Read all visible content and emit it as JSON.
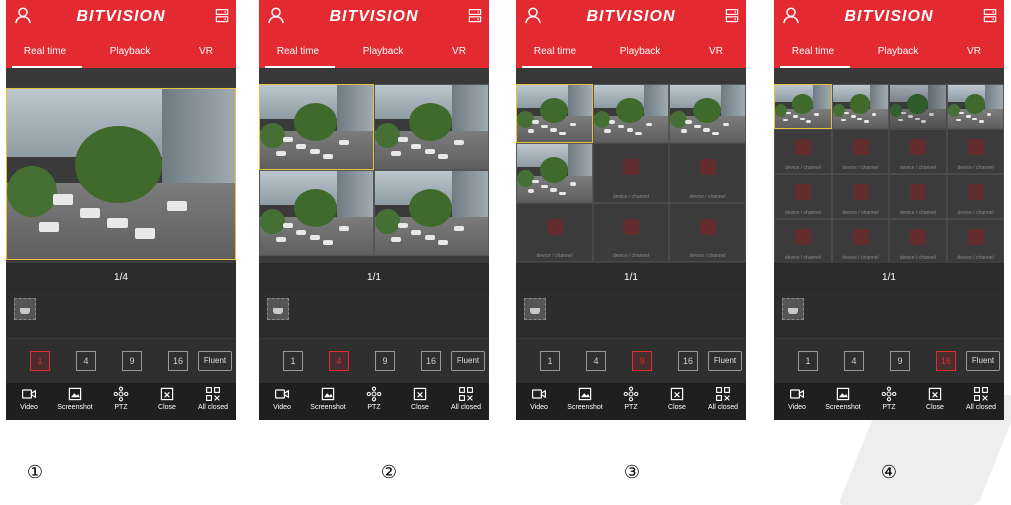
{
  "app": {
    "logo": "BITVISION",
    "brand_color": "#e32a30"
  },
  "tabs": [
    "Real time",
    "Playback",
    "VR"
  ],
  "split_options": [
    "1",
    "4",
    "9",
    "16"
  ],
  "fluent_label": "Fluent",
  "empty_channel_label": "device / channel",
  "toolbar": [
    {
      "label": "Video",
      "icon": "video-icon"
    },
    {
      "label": "Screenshot",
      "icon": "screenshot-icon"
    },
    {
      "label": "PTZ",
      "icon": "ptz-icon"
    },
    {
      "label": "Close",
      "icon": "close-icon"
    },
    {
      "label": "All closed",
      "icon": "all-closed-icon"
    }
  ],
  "screens": [
    {
      "label": "①",
      "page": "1/4",
      "grid": 1,
      "active_split": 0
    },
    {
      "label": "②",
      "page": "1/1",
      "grid": 2,
      "active_split": 1
    },
    {
      "label": "③",
      "page": "1/1",
      "grid": 3,
      "active_split": 2
    },
    {
      "label": "④",
      "page": "1/1",
      "grid": 4,
      "active_split": 3
    }
  ],
  "feeds_per_screen": [
    1,
    4,
    4,
    4
  ]
}
